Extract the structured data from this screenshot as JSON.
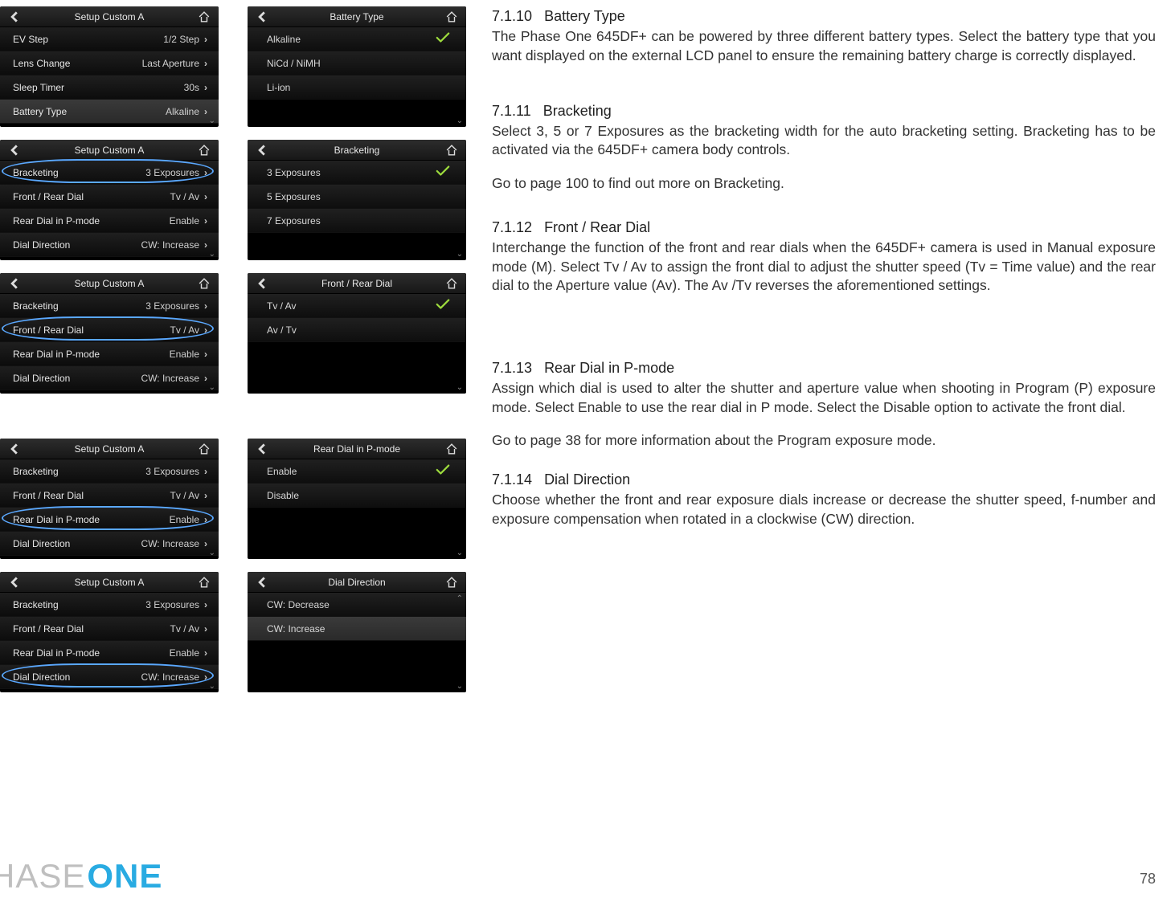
{
  "footer": {
    "brand_left": "HASE",
    "brand_right": "ONE",
    "page_number": "78"
  },
  "sections": [
    {
      "num": "7.1.10",
      "title": "Battery Type",
      "body": "The Phase One 645DF+ can be powered by three different battery types. Select the battery type that you want displayed on the external LCD panel to ensure the remaining battery charge is correctly displayed."
    },
    {
      "num": "7.1.11",
      "title": "Bracketing",
      "body": "Select 3, 5 or 7 Exposures as the bracketing width for the auto bracketing setting.  Bracketing has to be activated via the 645DF+ camera body controls.",
      "body2": "Go to page 100 to find out more on Bracketing."
    },
    {
      "num": "7.1.12",
      "title": "Front / Rear Dial",
      "body": "Interchange the function of the front and rear dials when the 645DF+ camera is used in Manual exposure mode (M). Select Tv / Av to assign the front dial to adjust the shutter speed (Tv = Time value) and the rear dial to the Aperture value (Av). The Av /Tv reverses the aforementioned settings."
    },
    {
      "num": "7.1.13",
      "title": "Rear Dial in P-mode",
      "body": "Assign which dial is used to alter the shutter and aperture value when shooting in Program (P) exposure mode. Select Enable to use the rear dial in P mode. Select the Disable option to activate the front dial.",
      "body2": "Go to page 38 for more information about the Program exposure mode."
    },
    {
      "num": "7.1.14",
      "title": "Dial Direction",
      "body": "Choose whether the front and rear exposure dials increase or decrease the shutter speed, f-number and exposure compensation when rotated in a clockwise (CW) direction."
    }
  ],
  "screens": {
    "setup_a_title": "Setup Custom A",
    "setup_a_1": [
      {
        "label": "EV Step",
        "value": "1/2 Step"
      },
      {
        "label": "Lens Change",
        "value": "Last Aperture"
      },
      {
        "label": "Sleep Timer",
        "value": "30s"
      },
      {
        "label": "Battery Type",
        "value": "Alkaline",
        "sel": true
      }
    ],
    "battery_title": "Battery Type",
    "battery_opts": [
      {
        "label": "Alkaline",
        "checked": true
      },
      {
        "label": "NiCd / NiMH"
      },
      {
        "label": "Li-ion"
      }
    ],
    "setup_a_2": [
      {
        "label": "Bracketing",
        "value": "3 Exposures",
        "sel": true
      },
      {
        "label": "Front / Rear Dial",
        "value": "Tv / Av"
      },
      {
        "label": "Rear Dial in P-mode",
        "value": "Enable"
      },
      {
        "label": "Dial Direction",
        "value": "CW: Increase"
      }
    ],
    "bracketing_title": "Bracketing",
    "bracketing_opts": [
      {
        "label": "3 Exposures",
        "checked": true
      },
      {
        "label": "5 Exposures"
      },
      {
        "label": "7 Exposures"
      }
    ],
    "frontrear_title": "Front / Rear Dial",
    "frontrear_opts": [
      {
        "label": "Tv / Av",
        "checked": true
      },
      {
        "label": "Av / Tv"
      }
    ],
    "reardial_title": "Rear Dial in P-mode",
    "reardial_opts": [
      {
        "label": "Enable",
        "checked": true
      },
      {
        "label": "Disable"
      }
    ],
    "dialdir_title": "Dial Direction",
    "dialdir_opts": [
      {
        "label": "CW: Decrease"
      },
      {
        "label": "CW: Increase",
        "sel": true
      }
    ]
  }
}
